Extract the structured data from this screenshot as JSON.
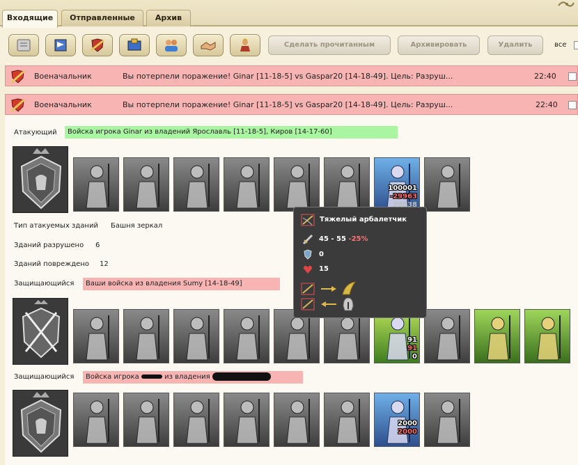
{
  "tabs": [
    {
      "label": "Входящие",
      "active": true
    },
    {
      "label": "Отправленные",
      "active": false
    },
    {
      "label": "Архив",
      "active": false
    }
  ],
  "toolbar": {
    "icon_buttons": [
      "scroll-icon",
      "flag-icon",
      "sword-shield-icon",
      "trade-icon",
      "family-icon",
      "handshake-icon",
      "hero-icon"
    ],
    "mark_read_label": "Сделать прочитанным",
    "archive_label": "Архивировать",
    "delete_label": "Удалить",
    "all_label": "все"
  },
  "messages": [
    {
      "from": "Военачальник",
      "subject": "Вы потерпели поражение! Ginar [11-18-5] vs Gaspar20 [14-18-49]. Цель: Разруш...",
      "time": "22:40"
    },
    {
      "from": "Военачальник",
      "subject": "Вы потерпели поражение! Ginar [11-18-5] vs Gaspar20 [14-18-49]. Цель: Разруш...",
      "time": "22:40"
    }
  ],
  "detail": {
    "attacker_label": "Атакующий",
    "attacker_value": "Войска игрока Ginar из владений Ярославль [11-18-5], Киров [14-17-60]",
    "attacker_units": [
      {
        "icon": "knight-icon"
      },
      {
        "icon": "spearman-icon"
      },
      {
        "icon": "horseman-icon"
      },
      {
        "icon": "griffin-icon"
      },
      {
        "icon": "crossbowman-icon"
      },
      {
        "icon": "monk-icon"
      },
      {
        "icon": "heavy-crossbowman-icon",
        "count": "100001",
        "loss": "-29963",
        "remaining": "70038",
        "highlighted": true
      },
      {
        "icon": "mage-icon"
      }
    ],
    "building_type_label": "Тип атакуемых зданий",
    "building_type_value": "Башня зеркал",
    "destroyed_label": "Зданий разрушено",
    "destroyed_value": "6",
    "damaged_label": "Зданий повреждено",
    "damaged_value": "12",
    "defender1_label": "Защищающийся",
    "defender1_value": "Ваши войска из владения Sumy [14-18-49]",
    "defender1_units": [
      {
        "icon": "dwarf-icon"
      },
      {
        "icon": "dark-knight-icon"
      },
      {
        "icon": "archer-icon"
      },
      {
        "icon": "manticore-icon"
      },
      {
        "icon": "elf-archer-icon"
      },
      {
        "icon": "druid-icon"
      },
      {
        "icon": "green-warrior-icon",
        "count": "91",
        "loss": "91",
        "remaining": "0",
        "highlighted": true
      },
      {
        "icon": "ent-icon"
      },
      {
        "icon": "tree-tower-icon",
        "building": true
      },
      {
        "icon": "light-tower-icon",
        "building": true
      }
    ],
    "defender2_label": "Защищающийся",
    "defender2_value_prefix": "Войска игрока",
    "defender2_value_middle": "из владения",
    "defender2_units": [
      {
        "icon": "knight-icon"
      },
      {
        "icon": "spearman-icon"
      },
      {
        "icon": "horseman-icon"
      },
      {
        "icon": "griffin-icon"
      },
      {
        "icon": "crossbowman-icon"
      },
      {
        "icon": "monk-icon"
      },
      {
        "icon": "heavy-crossbowman-icon",
        "count": "2000",
        "loss": "2000",
        "highlighted": true
      },
      {
        "icon": "mage-icon"
      }
    ]
  },
  "tooltip": {
    "title": "Тяжелый арбалетчик",
    "attack": "45 - 55",
    "attack_mod": "-25%",
    "defense": "0",
    "health": "15",
    "strong_icons": [
      "crossbow-icon",
      "arrow-right-icon",
      "wings-icon"
    ],
    "weak_icons": [
      "crossbow-icon",
      "arrow-left-icon",
      "helmet-icon"
    ]
  },
  "colors": {
    "message_row": "#f8b3b3",
    "attacker_highlight": "#a9f5a1",
    "defender_highlight": "#f8b3b3",
    "tooltip_bg": "#3b3b3b",
    "loss_red": "#ff6b6b"
  }
}
